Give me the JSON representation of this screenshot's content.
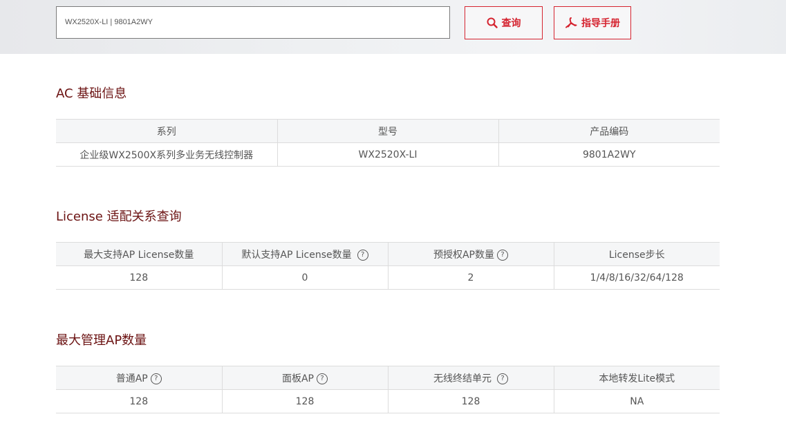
{
  "search": {
    "value": "WX2520X-LI   |   9801A2WY",
    "query_label": "查询",
    "guide_label": "指导手册"
  },
  "ac_info": {
    "title": "AC 基础信息",
    "headers": [
      "系列",
      "型号",
      "产品编码"
    ],
    "row": [
      "企业级WX2500X系列多业务无线控制器",
      "WX2520X-LI",
      "9801A2WY"
    ]
  },
  "license": {
    "title": "License 适配关系查询",
    "headers": [
      "最大支持AP License数量",
      "默认支持AP License数量",
      "预授权AP数量",
      "License步长"
    ],
    "row": [
      "128",
      "0",
      "2",
      "1/4/8/16/32/64/128"
    ]
  },
  "max_ap": {
    "title": "最大管理AP数量",
    "headers": [
      "普通AP",
      "面板AP",
      "无线终结单元",
      "本地转发Lite模式"
    ],
    "row": [
      "128",
      "128",
      "128",
      "NA"
    ]
  },
  "help_glyph": "?",
  "colors": {
    "accent": "#d5232f",
    "title": "#6b1212",
    "header_bg": "#f5f6f7"
  }
}
